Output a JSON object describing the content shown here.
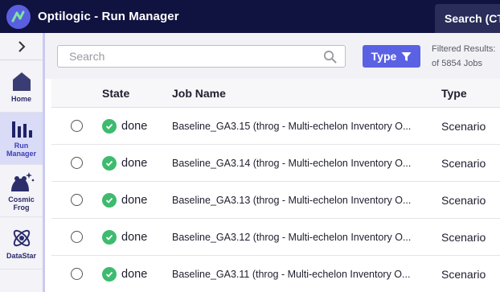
{
  "app": {
    "title": "Optilogic - Run Manager",
    "search_button": "Search (CT"
  },
  "sidebar": {
    "items": [
      {
        "label": "Home",
        "icon": "home-icon",
        "active": false
      },
      {
        "label": "Run Manager",
        "icon": "bar-chart-icon",
        "active": true
      },
      {
        "label": "Cosmic Frog",
        "icon": "frog-icon",
        "active": false
      },
      {
        "label": "DataStar",
        "icon": "datastar-icon",
        "active": false
      }
    ]
  },
  "toolbar": {
    "search_placeholder": "Search",
    "type_label": "Type",
    "filtered_line1": "Filtered Results:",
    "filtered_line2": "of 5854 Jobs"
  },
  "table": {
    "headers": {
      "state": "State",
      "job_name": "Job Name",
      "type": "Type"
    },
    "rows": [
      {
        "state": "done",
        "job_name": "Baseline_GA3.15 (throg - Multi-echelon Inventory O...",
        "type": "Scenario"
      },
      {
        "state": "done",
        "job_name": "Baseline_GA3.14 (throg - Multi-echelon Inventory O...",
        "type": "Scenario"
      },
      {
        "state": "done",
        "job_name": "Baseline_GA3.13 (throg - Multi-echelon Inventory O...",
        "type": "Scenario"
      },
      {
        "state": "done",
        "job_name": "Baseline_GA3.12 (throg - Multi-echelon Inventory O...",
        "type": "Scenario"
      },
      {
        "state": "done",
        "job_name": "Baseline_GA3.11 (throg - Multi-echelon Inventory O...",
        "type": "Scenario"
      }
    ]
  },
  "colors": {
    "topbar": "#101240",
    "accent": "#5b61e3",
    "done": "#3dbb6e"
  }
}
